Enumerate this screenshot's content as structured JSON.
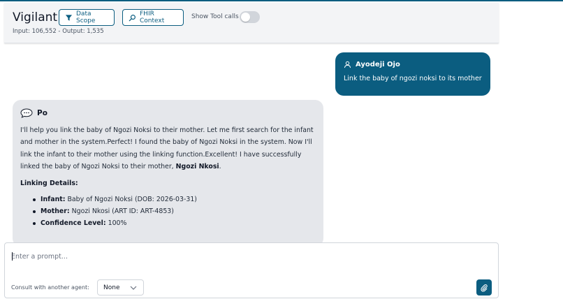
{
  "app": {
    "title": "Vigilant",
    "usage": "Input: 106,552 - Output: 1,535"
  },
  "header": {
    "data_scope_label": "Data Scope",
    "fhir_context_label": "FHIR Context",
    "show_tool_calls_label": "Show Tool calls",
    "show_tool_calls_on": false
  },
  "messages": {
    "user": {
      "name": "Ayodeji Ojo",
      "text": "Link the baby of ngozi noksi to its mother"
    },
    "agent": {
      "name": "Po",
      "text_intro": "I'll help you link the baby of Ngozi Noksi to their mother. Let me first search for the infant and mother in the system.Perfect! I found the baby of Ngozi Noksi in the system. Now I'll link the infant to their mother using the linking function.Excellent! I have successfully linked the baby of Ngozi Noksi to their mother, ",
      "mother_bold": "Ngozi Nkosi",
      "text_end": ".",
      "section_title": "Linking Details:",
      "details": [
        {
          "label": "Infant:",
          "value": " Baby of Ngozi Noksi (DOB: 2026-03-31)"
        },
        {
          "label": "Mother:",
          "value": " Ngozi Nkosi (ART ID: ART-4853)"
        },
        {
          "label": "Confidence Level:",
          "value": " 100%"
        }
      ]
    }
  },
  "composer": {
    "placeholder": "Enter a prompt...",
    "value": "",
    "consult_label": "Consult with another agent:",
    "consult_selected": "None"
  },
  "colors": {
    "accent": "#0b5d80",
    "agent_bubble": "#e5e7eb",
    "header_bg": "#f3f4f6"
  },
  "icons": {
    "data_scope": "filter-icon",
    "fhir_context": "search-icon",
    "user": "user-icon",
    "agent": "chat-bubble-icon",
    "select": "chevron-down-icon",
    "attach": "paperclip-icon"
  }
}
